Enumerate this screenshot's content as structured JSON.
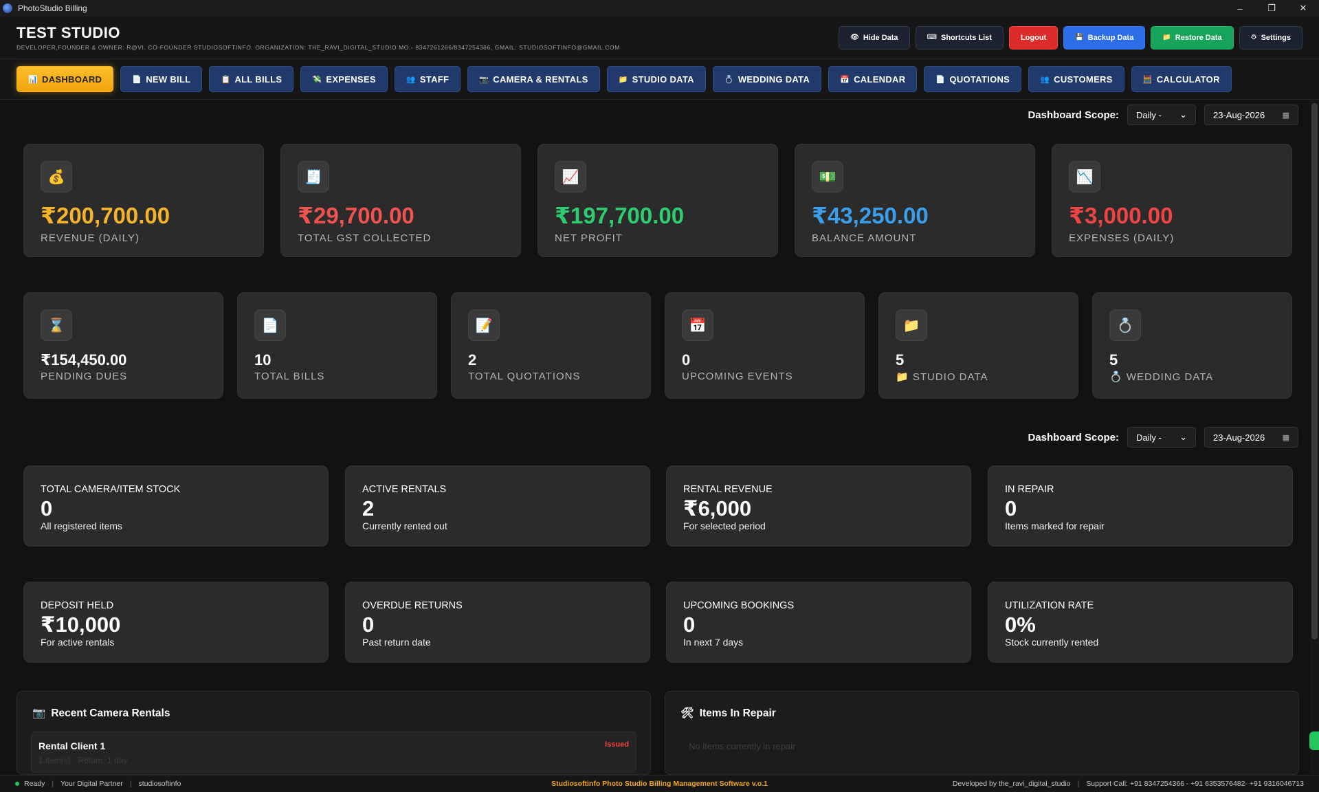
{
  "window": {
    "title": "PhotoStudio Billing",
    "controls": [
      "–",
      "❐",
      "✕"
    ]
  },
  "header": {
    "studio_name": "TEST STUDIO",
    "subtitle": "DEVELOPER,FOUNDER & OWNER: R@VI. CO-FOUNDER STUDIOSOFTINFO. ORGANIZATION: THE_RAVI_DIGITAL_STUDIO MO:- 8347261266/8347254366, GMAIL: STUDIOSOFTINFO@GMAIL.COM",
    "buttons": [
      {
        "label": "Hide Data",
        "icon": "👁"
      },
      {
        "label": "Shortcuts List",
        "icon": "⌨"
      },
      {
        "label": "Logout",
        "icon": ""
      },
      {
        "label": "Backup Data",
        "icon": "💾"
      },
      {
        "label": "Restore Data",
        "icon": "📁"
      },
      {
        "label": "Settings",
        "icon": "⚙"
      }
    ]
  },
  "nav": [
    {
      "label": "DASHBOARD",
      "icon": "📊"
    },
    {
      "label": "NEW BILL",
      "icon": "📄"
    },
    {
      "label": "ALL BILLS",
      "icon": "📋"
    },
    {
      "label": "EXPENSES",
      "icon": "💸"
    },
    {
      "label": "STAFF",
      "icon": "👥"
    },
    {
      "label": "CAMERA & RENTALS",
      "icon": "📷"
    },
    {
      "label": "STUDIO DATA",
      "icon": "📁"
    },
    {
      "label": "WEDDING DATA",
      "icon": "💍"
    },
    {
      "label": "CALENDAR",
      "icon": "📅"
    },
    {
      "label": "QUOTATIONS",
      "icon": "📄"
    },
    {
      "label": "CUSTOMERS",
      "icon": "👥"
    },
    {
      "label": "CALCULATOR",
      "icon": "🧮"
    }
  ],
  "scope": {
    "label": "Dashboard Scope:",
    "period": "Daily -",
    "date": "23-Aug-2026"
  },
  "kpis": [
    {
      "icon": "💰",
      "value": "₹200,700.00",
      "label": "REVENUE (DAILY)",
      "color": "#f5b32b"
    },
    {
      "icon": "🧾",
      "value": "₹29,700.00",
      "label": "TOTAL GST COLLECTED",
      "color": "#ef5350"
    },
    {
      "icon": "📈",
      "value": "₹197,700.00",
      "label": "NET PROFIT",
      "color": "#2ecc71"
    },
    {
      "icon": "💵",
      "value": "₹43,250.00",
      "label": "BALANCE AMOUNT",
      "color": "#3b9eea"
    },
    {
      "icon": "📉",
      "value": "₹3,000.00",
      "label": "EXPENSES (DAILY)",
      "color": "#ef4444"
    }
  ],
  "stats": [
    {
      "icon": "⌛",
      "value": "₹154,450.00",
      "label": "PENDING DUES"
    },
    {
      "icon": "📄",
      "value": "10",
      "label": "TOTAL BILLS"
    },
    {
      "icon": "📝",
      "value": "2",
      "label": "TOTAL QUOTATIONS"
    },
    {
      "icon": "📅",
      "value": "0",
      "label": "UPCOMING EVENTS"
    },
    {
      "icon": "📁",
      "value": "5",
      "label": "📁 STUDIO DATA"
    },
    {
      "icon": "💍",
      "value": "5",
      "label": "💍 WEDDING DATA"
    }
  ],
  "rentals_row1": [
    {
      "title": "TOTAL CAMERA/ITEM STOCK",
      "value": "0",
      "sub": "All registered items"
    },
    {
      "title": "ACTIVE RENTALS",
      "value": "2",
      "sub": "Currently rented out"
    },
    {
      "title": "RENTAL REVENUE",
      "value": "₹6,000",
      "sub": "For selected period"
    },
    {
      "title": "IN REPAIR",
      "value": "0",
      "sub": "Items marked for repair"
    }
  ],
  "rentals_row2": [
    {
      "title": "DEPOSIT HELD",
      "value": "₹10,000",
      "sub": "For active rentals"
    },
    {
      "title": "OVERDUE RETURNS",
      "value": "0",
      "sub": "Past return date"
    },
    {
      "title": "UPCOMING BOOKINGS",
      "value": "0",
      "sub": "In next 7 days"
    },
    {
      "title": "UTILIZATION RATE",
      "value": "0%",
      "sub": "Stock currently rented"
    }
  ],
  "recent_rentals": {
    "title": "Recent Camera Rentals",
    "icon": "📷",
    "items": [
      {
        "name": "Rental Client 1",
        "status": "Issued",
        "meta": "1 item(s) · Return: 1 day"
      }
    ]
  },
  "repair": {
    "title": "Items In Repair",
    "icon": "🛠",
    "empty": "No items currently in repair"
  },
  "status": {
    "ready": "Ready",
    "partner": "Your Digital Partner",
    "brand": "studiosoftinfo",
    "center": "Studiosoftinfo Photo Studio Billing Management Software v.o.1",
    "dev": "Developed by the_ravi_digital_studio",
    "support": "Support Call: +91 8347254366 - +91 6353576482- +91 9316046713"
  }
}
